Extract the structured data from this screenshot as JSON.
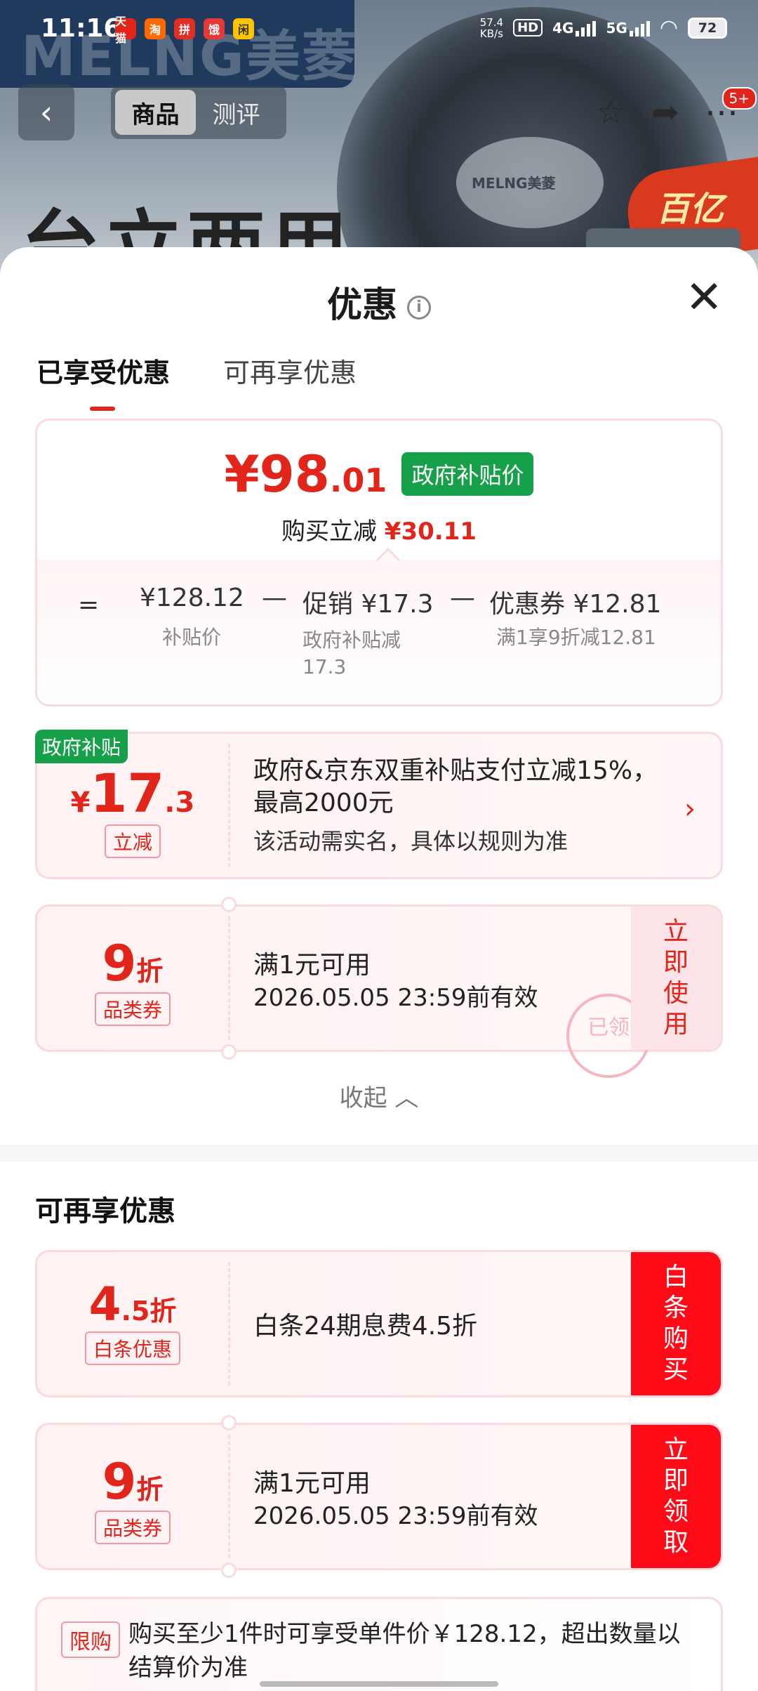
{
  "status_bar": {
    "time": "11:16",
    "app_icons": [
      {
        "label": "天猫",
        "color": "#e1251b"
      },
      {
        "label": "淘",
        "color": "#ff6a00"
      },
      {
        "label": "拼",
        "color": "#e02e24"
      },
      {
        "label": "饿",
        "color": "#e53935"
      },
      {
        "label": "闲",
        "color": "#ffc400"
      }
    ],
    "net_speed": "57.4",
    "net_unit": "KB/s",
    "hd": "HD",
    "signal1": "4G",
    "signal2": "5G",
    "battery": "72"
  },
  "product_bg": {
    "brand": "MELNG美菱",
    "fan_logo": "MELNG美菱",
    "title": "台立两用",
    "badge": "百亿"
  },
  "nav": {
    "back_icon": "chevron-left-icon",
    "tabs": [
      "商品",
      "测评"
    ],
    "active_tab": 0,
    "icons": [
      "star-icon",
      "share-icon",
      "more-icon"
    ],
    "message_count": "5+"
  },
  "sheet": {
    "title": "优惠",
    "tabs": [
      "已享受优惠",
      "可再享优惠"
    ],
    "price_card": {
      "currency": "¥",
      "price_int": "98",
      "price_dec": ".01",
      "price_tag": "政府补贴价",
      "discount_label": "购买立减",
      "discount_value": "¥30.11",
      "eq": "=",
      "minus": "—",
      "base_price": "¥128.12",
      "base_note": "补贴价",
      "promo": "促销 ¥17.3",
      "promo_note": "政府补贴减\n17.3",
      "coupon": "优惠券 ¥12.81",
      "coupon_note": "满1享9折减12.81"
    },
    "gov_card": {
      "label": "政府补贴",
      "currency": "¥",
      "amount_int": "17",
      "amount_dec": ".3",
      "pill": "立减",
      "text": "政府&京东双重补贴支付立减15%，最高2000元",
      "sub": "该活动需实名，具体以规则为准"
    },
    "used_coupon": {
      "discount": "9",
      "unit": "折",
      "pill": "品类券",
      "condition": "满1元可用",
      "expiry": "2026.05.05 23:59前有效",
      "action": "立即使用",
      "stamp": "已领"
    },
    "collapse": "收起",
    "section_title": "可再享优惠",
    "baitiao": {
      "discount_int": "4",
      "discount_dec": ".5",
      "unit": "折",
      "pill": "白条优惠",
      "text": "白条24期息费4.5折",
      "action": "白条购买"
    },
    "new_coupon": {
      "discount": "9",
      "unit": "折",
      "pill": "品类券",
      "condition": "满1元可用",
      "expiry": "2026.05.05 23:59前有效",
      "action": "立即领取"
    },
    "limit": {
      "pill": "限购",
      "text": "购买至少1件时可享受单件价￥128.12，超出数量以结算价为准"
    }
  }
}
